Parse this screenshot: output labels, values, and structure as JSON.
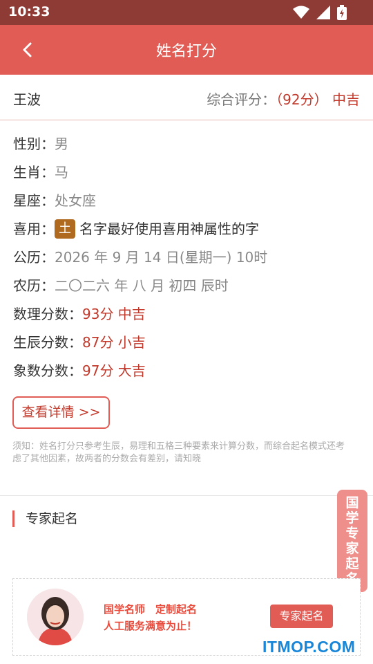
{
  "status_bar": {
    "time": "10:33"
  },
  "app_bar": {
    "title": "姓名打分",
    "back_icon": "chevron-left-icon"
  },
  "summary": {
    "name": "王波",
    "score_label": "综合评分：",
    "score_value": "（92分）",
    "score_grade": "中吉"
  },
  "info": {
    "gender_label": "性别：",
    "gender_value": "男",
    "zodiac_label": "生肖：",
    "zodiac_value": "马",
    "constellation_label": "星座：",
    "constellation_value": "处女座",
    "favor_label": "喜用：",
    "favor_tag": "土",
    "favor_text": "名字最好使用喜用神属性的字",
    "solar_label": "公历：",
    "solar_value": "2026 年 9 月 14 日(星期一) 10时",
    "lunar_label": "农历：",
    "lunar_value": "二〇二六 年 八 月 初四 辰时",
    "math_label": "数理分数：",
    "math_value": "93分 中吉",
    "birth_label": "生辰分数：",
    "birth_value": "87分 小吉",
    "image_label": "象数分数：",
    "image_value": "97分 大吉"
  },
  "detail_button": "查看详情 >>",
  "notice": "须知：姓名打分只参考生辰，易理和五格三种要素来计算分数，而综合起名模式还考虑了其他因素，故两者的分数会有差别，请知晓",
  "expert_section": {
    "title": "专家起名",
    "slogan_line1": "国学名师　定制起名",
    "slogan_line2": "人工服务满意为止！",
    "cta": "专家起名"
  },
  "float_badge": [
    "国",
    "学",
    "专",
    "家",
    "起",
    "名"
  ],
  "watermark": "ITMOP.COM",
  "colors": {
    "status_bar": "#8e3a35",
    "app_bar": "#e05c55",
    "accent_red": "#c0392b",
    "tag_brown": "#b06a1f",
    "watermark_blue": "#1a86d8"
  }
}
